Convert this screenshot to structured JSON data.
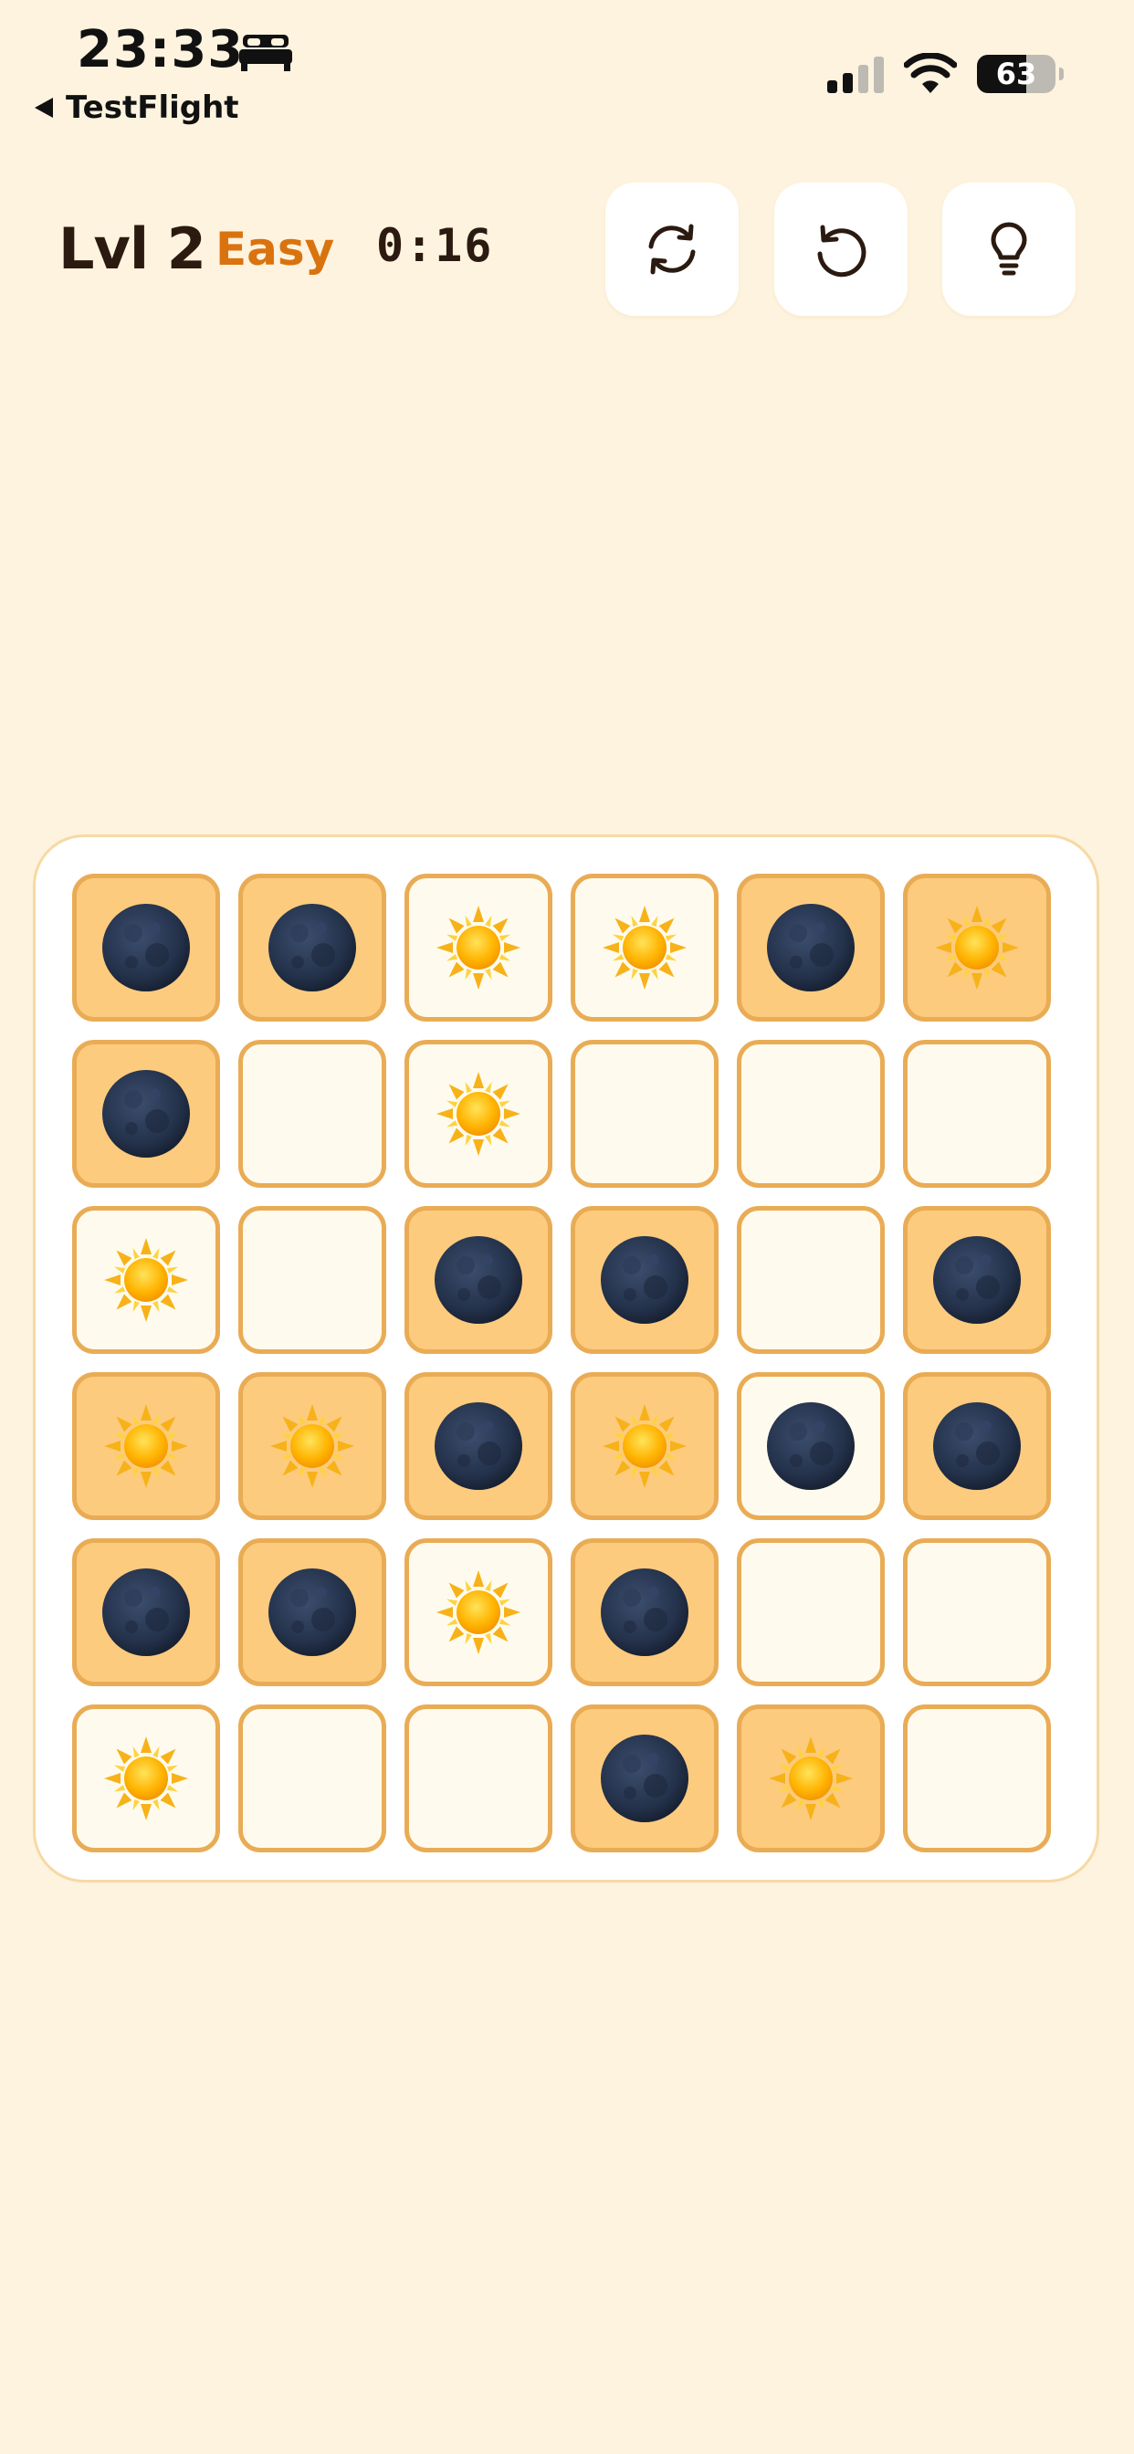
{
  "status_bar": {
    "time": "23:33",
    "back_app": "TestFlight",
    "battery": "63",
    "battery_level": 0.63
  },
  "header": {
    "level": "Lvl 2",
    "difficulty": "Easy",
    "timer": "0:16",
    "difficulty_color": "#D9730F"
  },
  "toolbar": {
    "buttons": [
      {
        "icon": "refresh-icon",
        "action": "new-puzzle"
      },
      {
        "icon": "undo-icon",
        "action": "undo"
      },
      {
        "icon": "lightbulb-icon",
        "action": "hint"
      }
    ]
  },
  "board": {
    "rows": 6,
    "cols": 6,
    "cells": [
      [
        {
          "symbol": "moon",
          "locked": true
        },
        {
          "symbol": "moon",
          "locked": true
        },
        {
          "symbol": "sun",
          "locked": false
        },
        {
          "symbol": "sun",
          "locked": false
        },
        {
          "symbol": "moon",
          "locked": true
        },
        {
          "symbol": "sun",
          "locked": true
        }
      ],
      [
        {
          "symbol": "moon",
          "locked": true
        },
        {
          "symbol": "",
          "locked": false
        },
        {
          "symbol": "sun",
          "locked": false
        },
        {
          "symbol": "",
          "locked": false
        },
        {
          "symbol": "",
          "locked": false
        },
        {
          "symbol": "",
          "locked": false
        }
      ],
      [
        {
          "symbol": "sun",
          "locked": false
        },
        {
          "symbol": "",
          "locked": false
        },
        {
          "symbol": "moon",
          "locked": true
        },
        {
          "symbol": "moon",
          "locked": true
        },
        {
          "symbol": "",
          "locked": false
        },
        {
          "symbol": "moon",
          "locked": true
        }
      ],
      [
        {
          "symbol": "sun",
          "locked": true
        },
        {
          "symbol": "sun",
          "locked": true
        },
        {
          "symbol": "moon",
          "locked": true
        },
        {
          "symbol": "sun",
          "locked": true
        },
        {
          "symbol": "moon",
          "locked": false
        },
        {
          "symbol": "moon",
          "locked": true
        }
      ],
      [
        {
          "symbol": "moon",
          "locked": true
        },
        {
          "symbol": "moon",
          "locked": true
        },
        {
          "symbol": "sun",
          "locked": false
        },
        {
          "symbol": "moon",
          "locked": true
        },
        {
          "symbol": "",
          "locked": false
        },
        {
          "symbol": "",
          "locked": false
        }
      ],
      [
        {
          "symbol": "sun",
          "locked": false
        },
        {
          "symbol": "",
          "locked": false
        },
        {
          "symbol": "",
          "locked": false
        },
        {
          "symbol": "moon",
          "locked": true
        },
        {
          "symbol": "sun",
          "locked": true
        },
        {
          "symbol": "",
          "locked": false
        }
      ]
    ],
    "colors": {
      "locked_fill": "#FDCB7E",
      "open_fill": "#FEFBEE",
      "cell_border": "#E9AC55"
    }
  }
}
